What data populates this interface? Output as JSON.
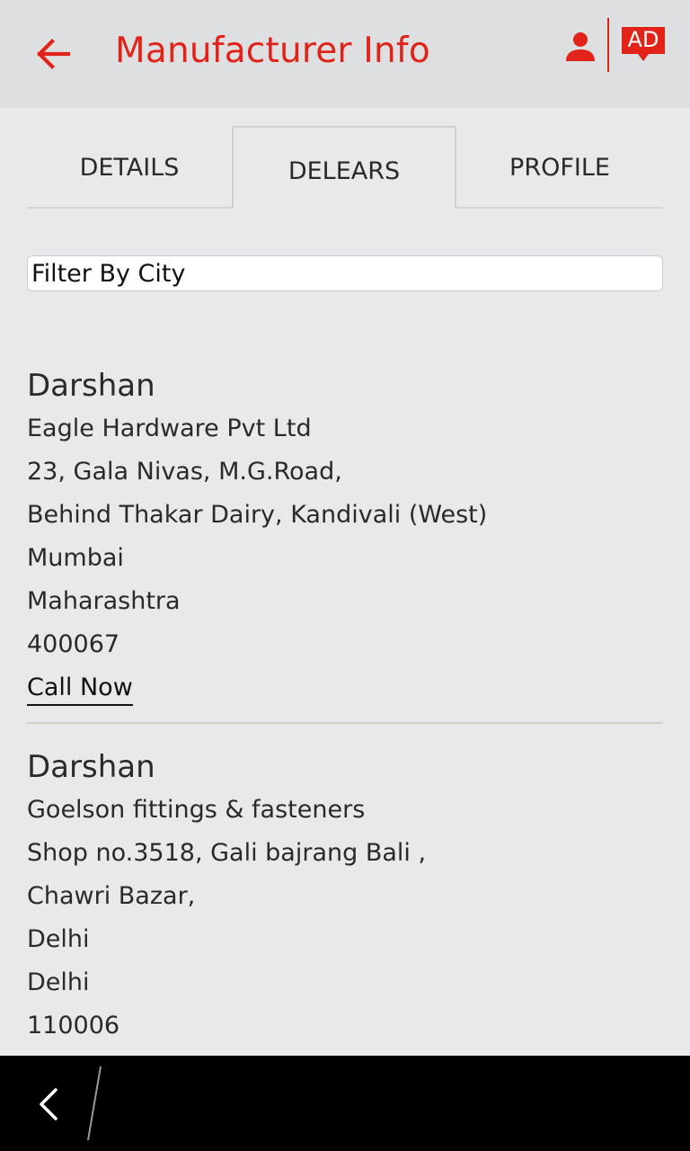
{
  "header": {
    "title": "Manufacturer Info",
    "back_icon": "arrow-left-icon",
    "user_icon": "person-icon",
    "ad_label": "AD",
    "accent_color": "#e2231a"
  },
  "tabs": [
    {
      "label": "DETAILS",
      "selected": false
    },
    {
      "label": "DELEARS",
      "selected": true
    },
    {
      "label": "PROFILE",
      "selected": false
    }
  ],
  "filter": {
    "placeholder": "Filter By City",
    "value": ""
  },
  "dealers": [
    {
      "name": "Darshan",
      "company": "Eagle Hardware Pvt Ltd",
      "address1": "23, Gala Nivas, M.G.Road,",
      "address2": "Behind Thakar Dairy, Kandivali (West)",
      "city": "Mumbai",
      "state": "Maharashtra",
      "pincode": "400067",
      "call_label": "Call Now"
    },
    {
      "name": "Darshan",
      "company": "Goelson fittings & fasteners",
      "address1": "Shop no.3518, Gali bajrang Bali ,",
      "address2": "Chawri Bazar,",
      "city": "Delhi",
      "state": "Delhi",
      "pincode": "110006"
    }
  ],
  "system_nav": {
    "back_icon": "chevron-left-icon"
  }
}
